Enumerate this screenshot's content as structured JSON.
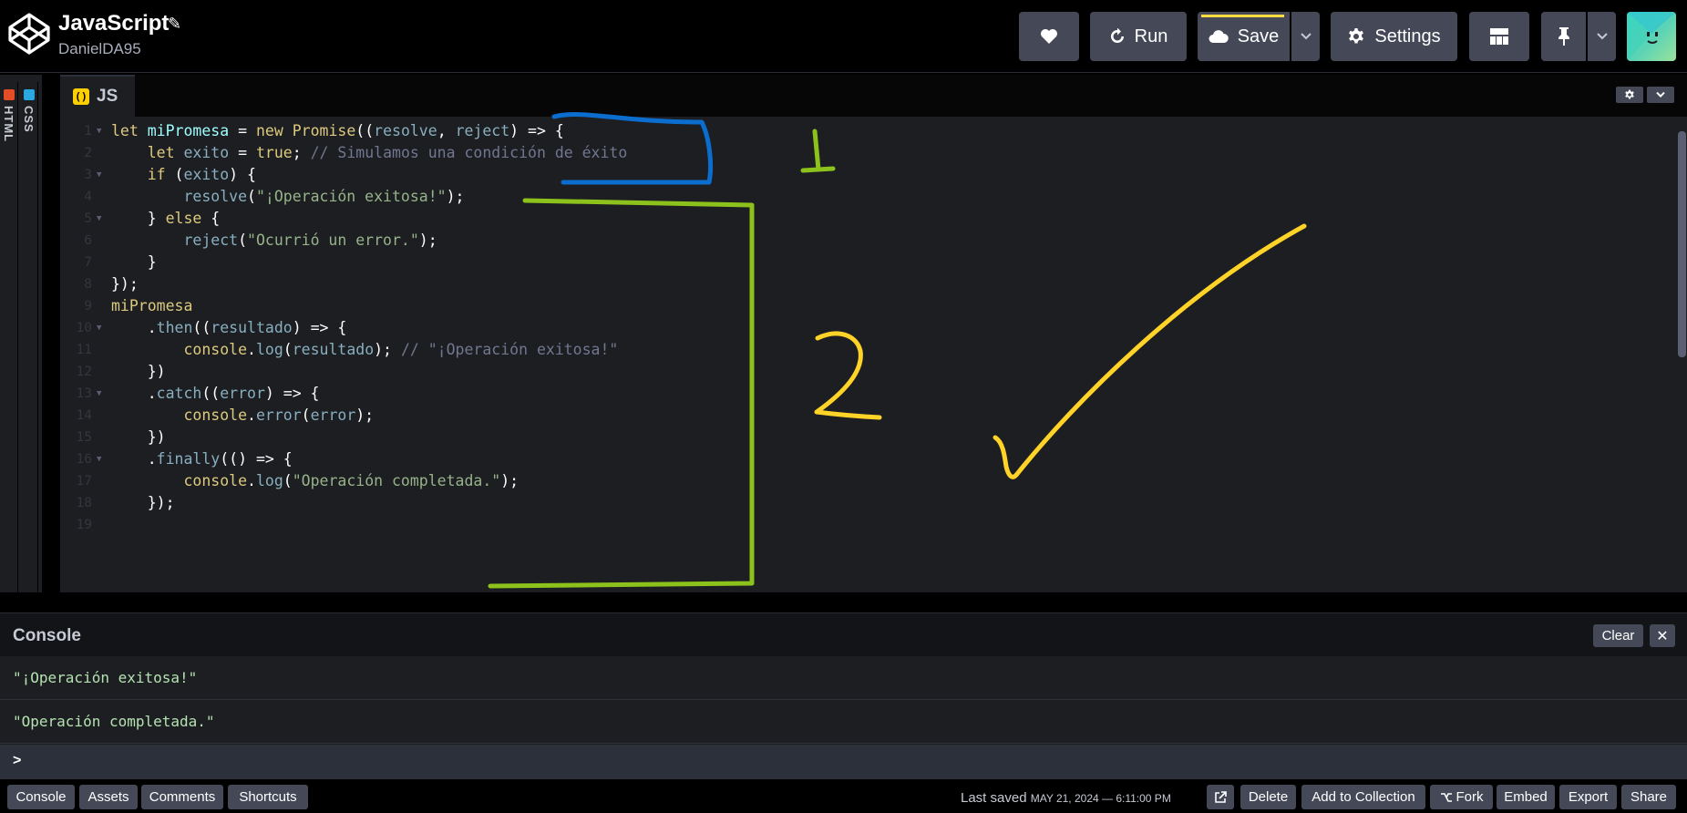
{
  "header": {
    "title": "JavaScript",
    "author": "DanielDA95",
    "buttons": {
      "run": "Run",
      "save": "Save",
      "settings": "Settings"
    }
  },
  "side_tabs": [
    "HTML",
    "CSS"
  ],
  "editor": {
    "tab_label": "JS",
    "line_numbers": [
      "1",
      "2",
      "3",
      "4",
      "5",
      "6",
      "7",
      "8",
      "9",
      "10",
      "11",
      "12",
      "13",
      "14",
      "15",
      "16",
      "17",
      "18",
      "19"
    ]
  },
  "console": {
    "title": "Console",
    "clear_label": "Clear",
    "close_label": "✕",
    "logs": [
      "\"¡Operación exitosa!\"",
      "\"Operación completada.\""
    ],
    "prompt": ">"
  },
  "footer": {
    "left_buttons": [
      "Console",
      "Assets",
      "Comments",
      "Shortcuts"
    ],
    "last_saved_label": "Last saved",
    "last_saved_date": "MAY 21, 2024 — 6:11:00 PM",
    "right_buttons": [
      "Delete",
      "Add to Collection",
      "Fork",
      "Embed",
      "Export",
      "Share"
    ]
  },
  "annotations": [
    "1",
    "2"
  ],
  "colors": {
    "accent_yellow": "#ffdd40",
    "annotation_blue": "#0b6ecf",
    "annotation_green": "#8cc21b",
    "annotation_yellow": "#ffd327"
  }
}
